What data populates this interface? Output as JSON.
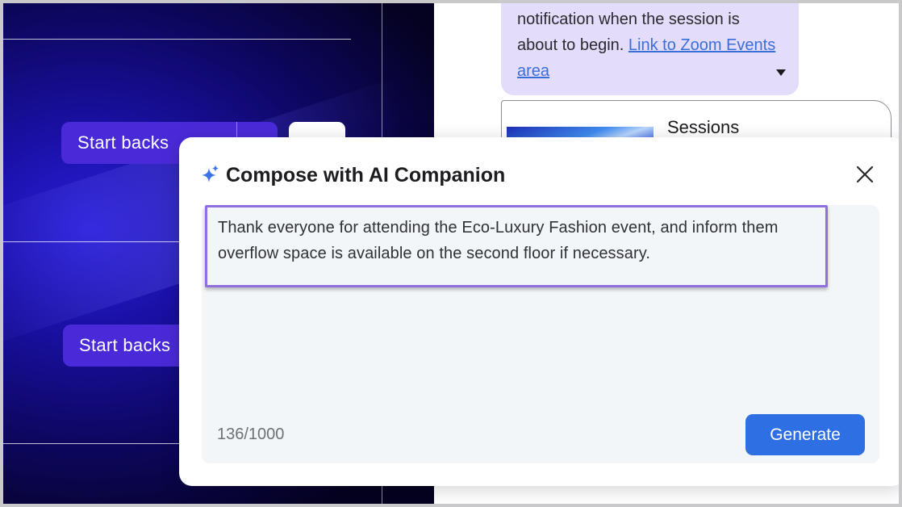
{
  "backstage": {
    "button_1_label": "Start backs",
    "button_2_label": "Start backs"
  },
  "chat": {
    "message_text": "notification when the session is about to begin.",
    "message_link": "Link to Zoom Events area",
    "session_card_title": "Sessions"
  },
  "modal": {
    "title": "Compose with AI Companion",
    "prompt_text": "Thank everyone for attending the Eco-Luxury Fashion event, and inform them overflow space is available on the second floor if necessary.",
    "char_count": "136/1000",
    "generate_label": "Generate"
  },
  "colors": {
    "accent_purple": "#4a2ad8",
    "primary_blue": "#2f6fe4",
    "bubble_lilac": "#e4dcfb",
    "focus_outline": "#8f6ee0"
  },
  "icons": {
    "sparkle": "sparkle-icon",
    "close": "close-icon",
    "dropdown": "caret-down-icon"
  }
}
